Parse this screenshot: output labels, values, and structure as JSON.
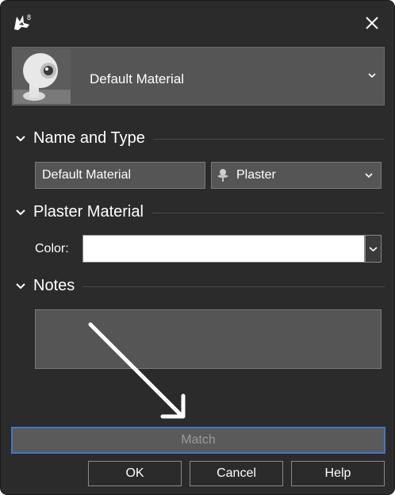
{
  "window": {
    "app_icon": "rhino-8-icon",
    "close_icon": "close-icon",
    "app_icon_badge": "8"
  },
  "preview": {
    "material_name": "Default Material",
    "thumbnail": "material-preview-sphere-image",
    "dropdown_icon": "chevron-down-icon"
  },
  "sections": {
    "name_type": {
      "title": "Name and Type"
    },
    "plaster": {
      "title": "Plaster Material"
    },
    "notes": {
      "title": "Notes"
    }
  },
  "fields": {
    "name_value": "Default Material",
    "type_value": "Plaster",
    "type_icon": "plaster-bust-icon",
    "color_label": "Color:",
    "color_value": "#ffffff",
    "notes_value": ""
  },
  "buttons": {
    "match": "Match",
    "ok": "OK",
    "cancel": "Cancel",
    "help": "Help"
  },
  "colors": {
    "background": "#2b2b2b",
    "field": "#555555",
    "focus_border": "#3f78c8"
  }
}
